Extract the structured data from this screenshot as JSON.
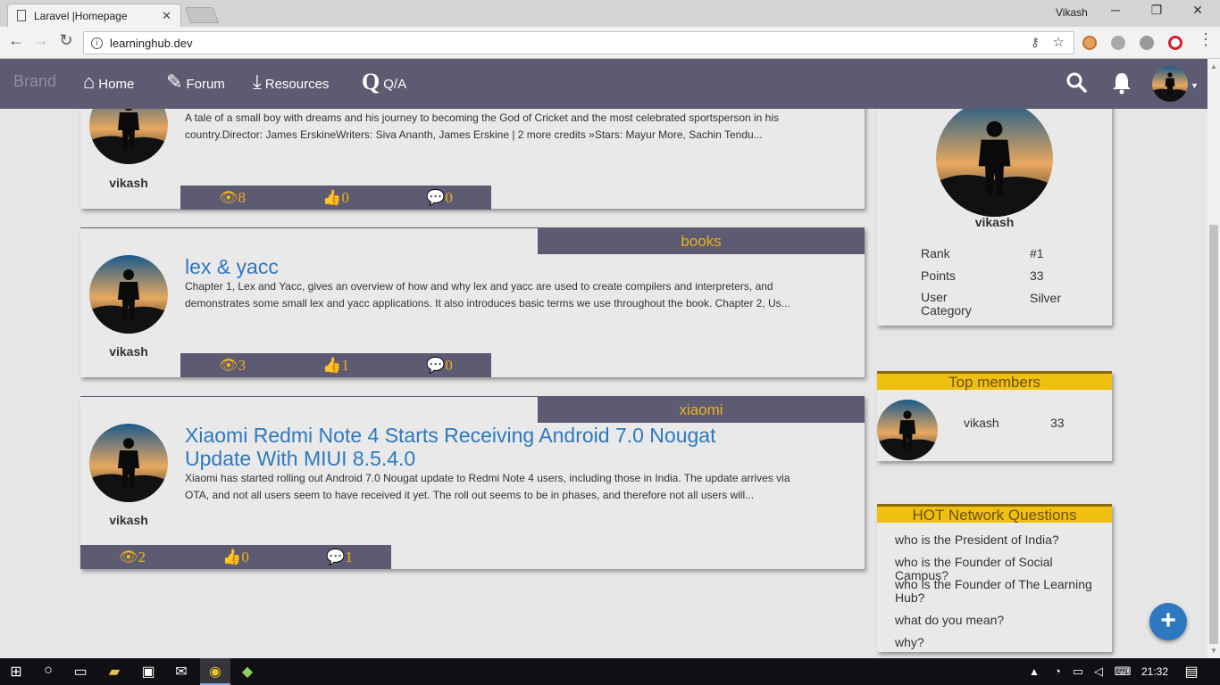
{
  "browser": {
    "tab_title": "Laravel |Homepage",
    "url": "learninghub.dev",
    "window_user": "Vikash"
  },
  "navbar": {
    "brand": "Brand",
    "links": [
      {
        "label": "Home",
        "icon": "home-icon"
      },
      {
        "label": "Forum",
        "icon": "edit-icon"
      },
      {
        "label": "Resources",
        "icon": "download-icon"
      },
      {
        "label": "Q/A",
        "icon": "q-icon"
      }
    ]
  },
  "posts": [
    {
      "author": "vikash",
      "category": "",
      "title": "",
      "description_line1": "A tale of a small boy with dreams and his journey to becoming the God of Cricket and the most celebrated sportsperson in his",
      "description_line2": "country.Director: James ErskineWriters: Siva Ananth, James Erskine | 2 more credits »Stars: Mayur More, Sachin Tendu...",
      "views": "8",
      "likes": "0",
      "comments": "0"
    },
    {
      "author": "vikash",
      "category": "books",
      "title": "lex & yacc",
      "description_line1": "Chapter 1, Lex and Yacc, gives an overview of how and why lex and yacc are used to create compilers and interpreters, and",
      "description_line2": "demonstrates some small lex and yacc applications. It also introduces basic terms we use throughout the book. Chapter 2, Us...",
      "views": "3",
      "likes": "1",
      "comments": "0"
    },
    {
      "author": "vikash",
      "category": "xiaomi",
      "title_line1": "Xiaomi Redmi Note 4 Starts Receiving Android 7.0 Nougat",
      "title_line2": "Update With MIUI 8.5.4.0",
      "description_line1": "Xiaomi has started rolling out Android 7.0 Nougat update to Redmi Note 4 users, including those in India. The update arrives via",
      "description_line2": "OTA, and not all users seem to have received it yet. The roll out seems to be in phases, and therefore not all users will...",
      "views": "2",
      "likes": "0",
      "comments": "1"
    }
  ],
  "profile": {
    "name": "vikash",
    "rank_label": "Rank",
    "rank_value": "#1",
    "points_label": "Points",
    "points_value": "33",
    "category_label_1": "User",
    "category_label_2": "Category",
    "category_value": "Silver"
  },
  "top_members": {
    "title": "Top members",
    "members": [
      {
        "name": "vikash",
        "points": "33"
      }
    ]
  },
  "hot_questions": {
    "title": "HOT Network Questions",
    "items": [
      "who is the President of India?",
      "who is the Founder of Social Campus?",
      "who is the Founder of The Learning Hub?",
      "what do you mean?",
      "why?"
    ]
  },
  "fab_label": "+",
  "taskbar": {
    "time": "21:32"
  },
  "colors": {
    "navbar": "#5d5b72",
    "accent_yellow": "#f0b020",
    "link_blue": "#2e78c0",
    "background": "#e6e6e6"
  }
}
